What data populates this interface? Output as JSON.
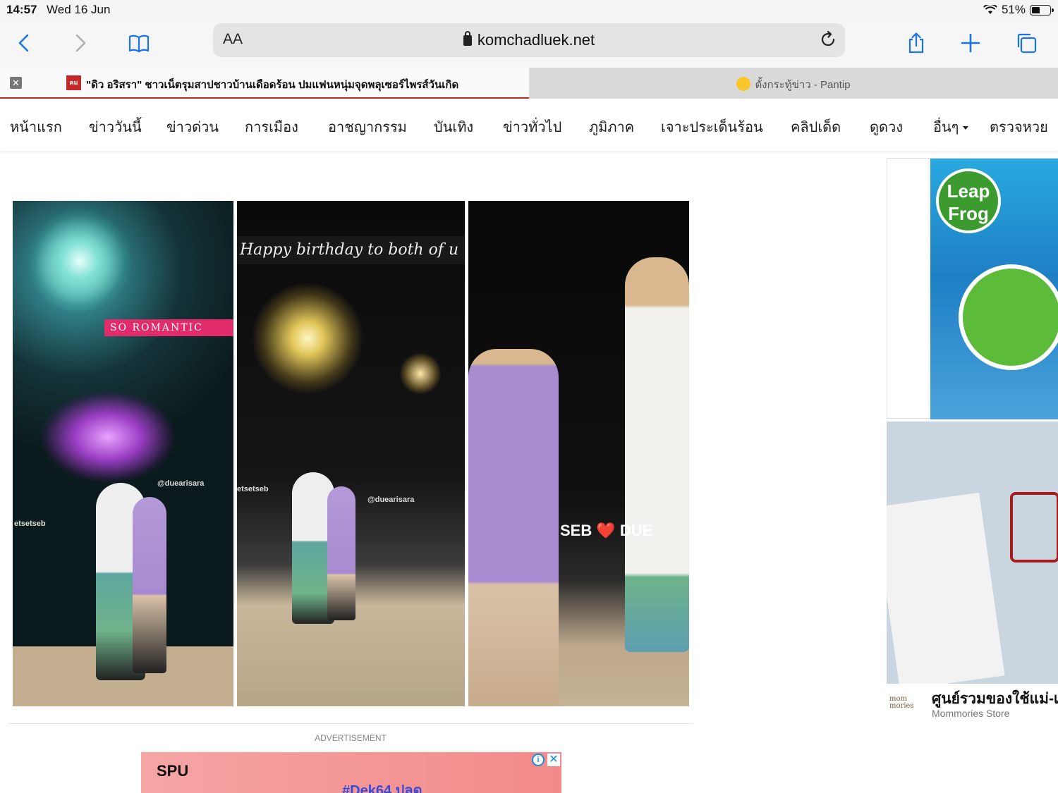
{
  "status_bar": {
    "time": "14:57",
    "date": "Wed 16 Jun",
    "battery": "51%",
    "battery_level": 0.51
  },
  "toolbar": {
    "aa_label": "AA",
    "url": "komchadluek.net",
    "icons": [
      "back-icon",
      "forward-icon",
      "bookmarks-icon",
      "reload-icon",
      "share-icon",
      "new-tab-icon",
      "tabs-overview-icon"
    ]
  },
  "tabs": [
    {
      "title": "\"ดิว อริสรา\" ชาวเน็ตรุมสาปชาวบ้านเดือดร้อน ปมแฟนหนุ่มจุดพลุเซอร์ไพรส์วันเกิด",
      "favicon_text": "คม",
      "active": true
    },
    {
      "title": "ตั้งกระทู้ข่าว - Pantip",
      "active": false
    }
  ],
  "nav": {
    "items": [
      "หน้าแรก",
      "ข่าววันนี้",
      "ข่าวด่วน",
      "การเมือง",
      "อาชญากรรม",
      "บันเทิง",
      "ข่าวทั่วไป",
      "ภูมิภาค",
      "เจาะประเด็นร้อน",
      "คลิปเด็ด",
      "ดูดวง",
      "อื่นๆ",
      "ตรวจหวย"
    ]
  },
  "article_image": {
    "panel1": {
      "caption": "SO ROMANTIC",
      "handle_a": "@duearisara",
      "handle_b": "etsetseb"
    },
    "panel2": {
      "caption": "Happy birthday to both of u",
      "handle_a": "@duearisara",
      "handle_b": "etsetseb"
    },
    "panel3": {
      "caption": "SEB ❤️ DUE"
    }
  },
  "advertisement": {
    "label": "ADVERTISEMENT",
    "brand": "SPU",
    "tagline": "#Dek64 ปลด",
    "info_icon": "info-icon",
    "close_icon": "close-icon"
  },
  "sidebar_ad": {
    "logo_text": "Leap Frog",
    "title": "ศูนย์รวมของใช้แม่-เ",
    "store": "Mommories Store",
    "store_logo": "mom mories"
  },
  "colors": {
    "accent_red": "#c62828",
    "ios_blue": "#1a73e8"
  }
}
